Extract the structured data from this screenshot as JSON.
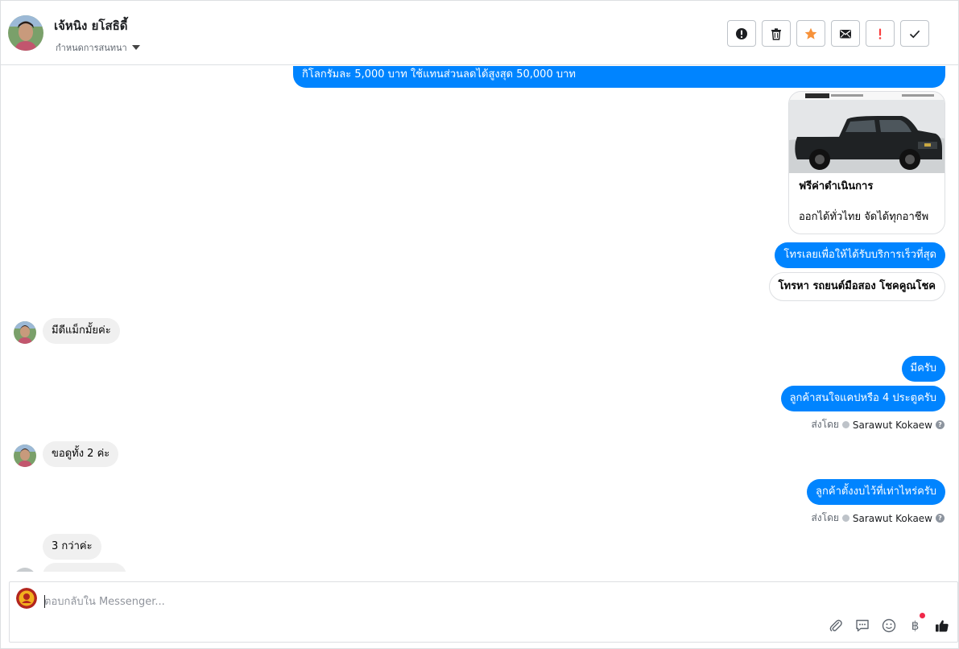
{
  "header": {
    "contact_name": "เจ้หนิง ยโสธิดี้",
    "stage_label": "กำหนดการสนทนา",
    "actions": [
      {
        "name": "report-spam-button",
        "icon": "alert-circle-icon"
      },
      {
        "name": "delete-button",
        "icon": "trash-icon"
      },
      {
        "name": "star-button",
        "icon": "star-icon"
      },
      {
        "name": "mark-unread-button",
        "icon": "envelope-icon"
      },
      {
        "name": "mark-important-button",
        "icon": "exclamation-icon"
      },
      {
        "name": "mark-done-button",
        "icon": "checkmark-icon"
      }
    ]
  },
  "conversation": {
    "msg_partial": "กิโลกรัมละ 5,000 บาท ใช้แทนส่วนลดได้สูงสุด 50,000 บาท",
    "card": {
      "title": "ฟรีค่าดำเนินการ",
      "subtitle": "ออกได้ทั่วไทย จัดได้ทุกอาชีพ"
    },
    "msg_call": "โทรเลยเพื่อให้ได้รับบริการเร็วที่สุด",
    "quick_reply": "โทรหา รถยนต์มือสอง โชคคูณโชค",
    "in_1": "มีดีแม็กมั้ยค่ะ",
    "out_1": "มีครับ",
    "out_2": "ลูกค้าสนใจแคปหรือ 4 ประตูครับ",
    "sent_by_prefix": "ส่งโดย",
    "sender": "Sarawut Kokaew",
    "in_2": "ขอดูทั้ง 2 ค่ะ",
    "out_3": "ลูกค้าตั้งงบไว้ที่เท่าไหร่ครับ",
    "in_3": "3 กว่าค่ะ"
  },
  "composer": {
    "placeholder": "ตอบกลับใน Messenger...",
    "tools": [
      "attach-icon",
      "saved-replies-icon",
      "emoji-icon",
      "baht-icon",
      "like-icon"
    ],
    "baht_symbol": "฿"
  },
  "colors": {
    "outgoing_bubble": "#0084ff",
    "incoming_bubble": "#f0f0f0",
    "star": "#f7923a",
    "important": "#fa3e3e"
  }
}
